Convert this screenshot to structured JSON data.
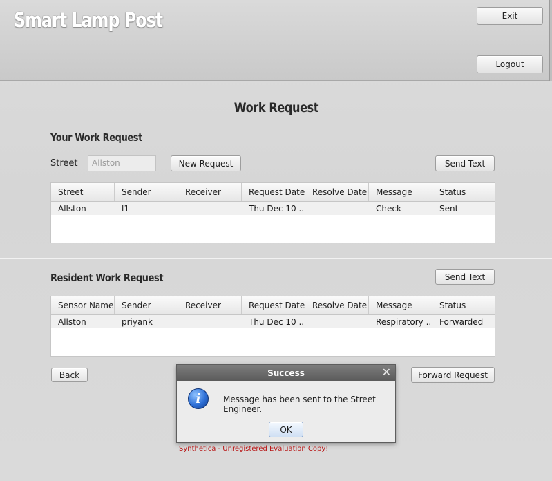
{
  "header": {
    "app_title": "Smart Lamp Post",
    "exit_label": "Exit",
    "logout_label": "Logout"
  },
  "page": {
    "title": "Work Request"
  },
  "your_request": {
    "title": "Your Work Request",
    "street_label": "Street",
    "street_placeholder": "Allston",
    "new_request_label": "New Request",
    "send_text_label": "Send Text",
    "columns": [
      "Street",
      "Sender",
      "Receiver",
      "Request Date",
      "Resolve Date",
      "Message",
      "Status"
    ],
    "rows": [
      [
        "Allston",
        "l1",
        "",
        "Thu Dec 10 ...",
        "",
        "Check",
        "Sent"
      ]
    ]
  },
  "resident_request": {
    "title": "Resident Work Request",
    "send_text_label": "Send Text",
    "columns": [
      "Sensor Name",
      "Sender",
      "Receiver",
      "Request Date",
      "Resolve Date",
      "Message",
      "Status"
    ],
    "rows": [
      [
        "Allston",
        "priyank",
        "",
        "Thu Dec 10 ...",
        "",
        "Respiratory ...",
        "Forwarded"
      ]
    ]
  },
  "footer": {
    "back_label": "Back",
    "forward_label": "Forward Request"
  },
  "dialog": {
    "title": "Success",
    "close_glyph": "✕",
    "icon": "info-icon",
    "message": "Message has been sent to the Street Engineer.",
    "ok_label": "OK"
  },
  "watermark": "Synthetica - Unregistered Evaluation Copy!",
  "colors": {
    "dialog_title_bg": "#6b6b6b",
    "watermark": "#b81414",
    "info_icon": "#2d6fd6"
  }
}
